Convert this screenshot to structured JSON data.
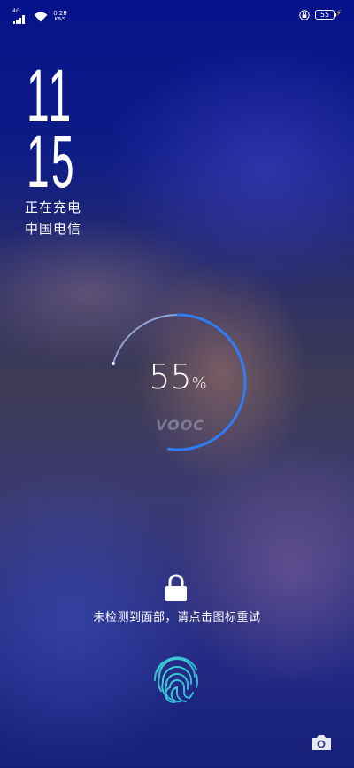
{
  "status_bar": {
    "network_type": "4G",
    "net_speed_value": "0.28",
    "net_speed_unit": "KB/S",
    "battery_level": "55",
    "icons": [
      "signal-icon",
      "wifi-icon",
      "rotation-lock-icon",
      "battery-icon",
      "charging-bolt-icon"
    ]
  },
  "lockscreen": {
    "time_hour": "11",
    "time_minute": "15",
    "charging_status": "正在充电",
    "carrier": "中国电信"
  },
  "charging": {
    "percent_value": "55",
    "percent_symbol": "%",
    "level": 0.55,
    "brand": "VOOC",
    "ring_color": "#2f7df5"
  },
  "unlock": {
    "message": "未检测到面部，请点击图标重试"
  },
  "fingerprint": {
    "colors": [
      "#3fd3d0",
      "#2fa7d8"
    ]
  }
}
